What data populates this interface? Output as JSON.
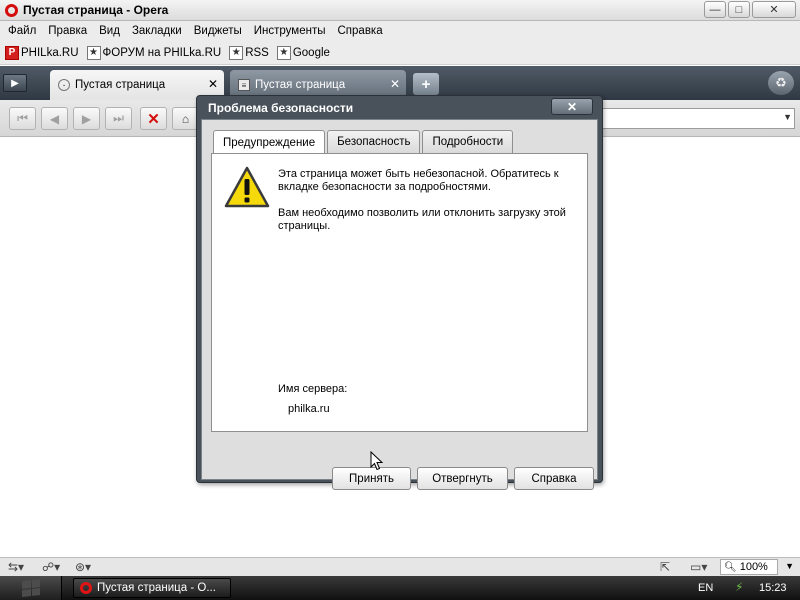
{
  "window": {
    "title": "Пустая страница - Opera",
    "minimize": "—",
    "maximize": "□",
    "close": "✕"
  },
  "menu": {
    "items": [
      "Файл",
      "Правка",
      "Вид",
      "Закладки",
      "Виджеты",
      "Инструменты",
      "Справка"
    ]
  },
  "bookmarks": {
    "items": [
      {
        "label": "PHILka.RU",
        "icon": "philka-logo-icon"
      },
      {
        "label": "ФОРУМ на PHILka.RU",
        "icon": "bookmark-star-icon"
      },
      {
        "label": "RSS",
        "icon": "bookmark-star-icon"
      },
      {
        "label": "Google",
        "icon": "bookmark-star-icon"
      }
    ]
  },
  "tabs": {
    "items": [
      {
        "label": "Пустая страница",
        "active": true
      },
      {
        "label": "Пустая страница",
        "active": false
      }
    ]
  },
  "dialog": {
    "title": "Проблема безопасности",
    "tabs": [
      "Предупреждение",
      "Безопасность",
      "Подробности"
    ],
    "active_tab": "Предупреждение",
    "message1": "Эта страница может быть небезопасной. Обратитесь к вкладке безопасности за подробностями.",
    "message2": "Вам необходимо позволить или отклонить загрузку этой страницы.",
    "server_label": "Имя сервера:",
    "server_value": "philka.ru",
    "buttons": {
      "accept": "Принять",
      "reject": "Отвергнуть",
      "help": "Справка"
    }
  },
  "statusbar": {
    "zoom": "100%"
  },
  "taskbar": {
    "task_label": "Пустая страница - O...",
    "language": "EN",
    "clock": "15:23"
  },
  "colors": {
    "opera_red": "#d40c0c",
    "dialog_frame": "#49525b",
    "tabbar_dark": "#2f3842",
    "warning_yellow": "#f5d90a"
  }
}
